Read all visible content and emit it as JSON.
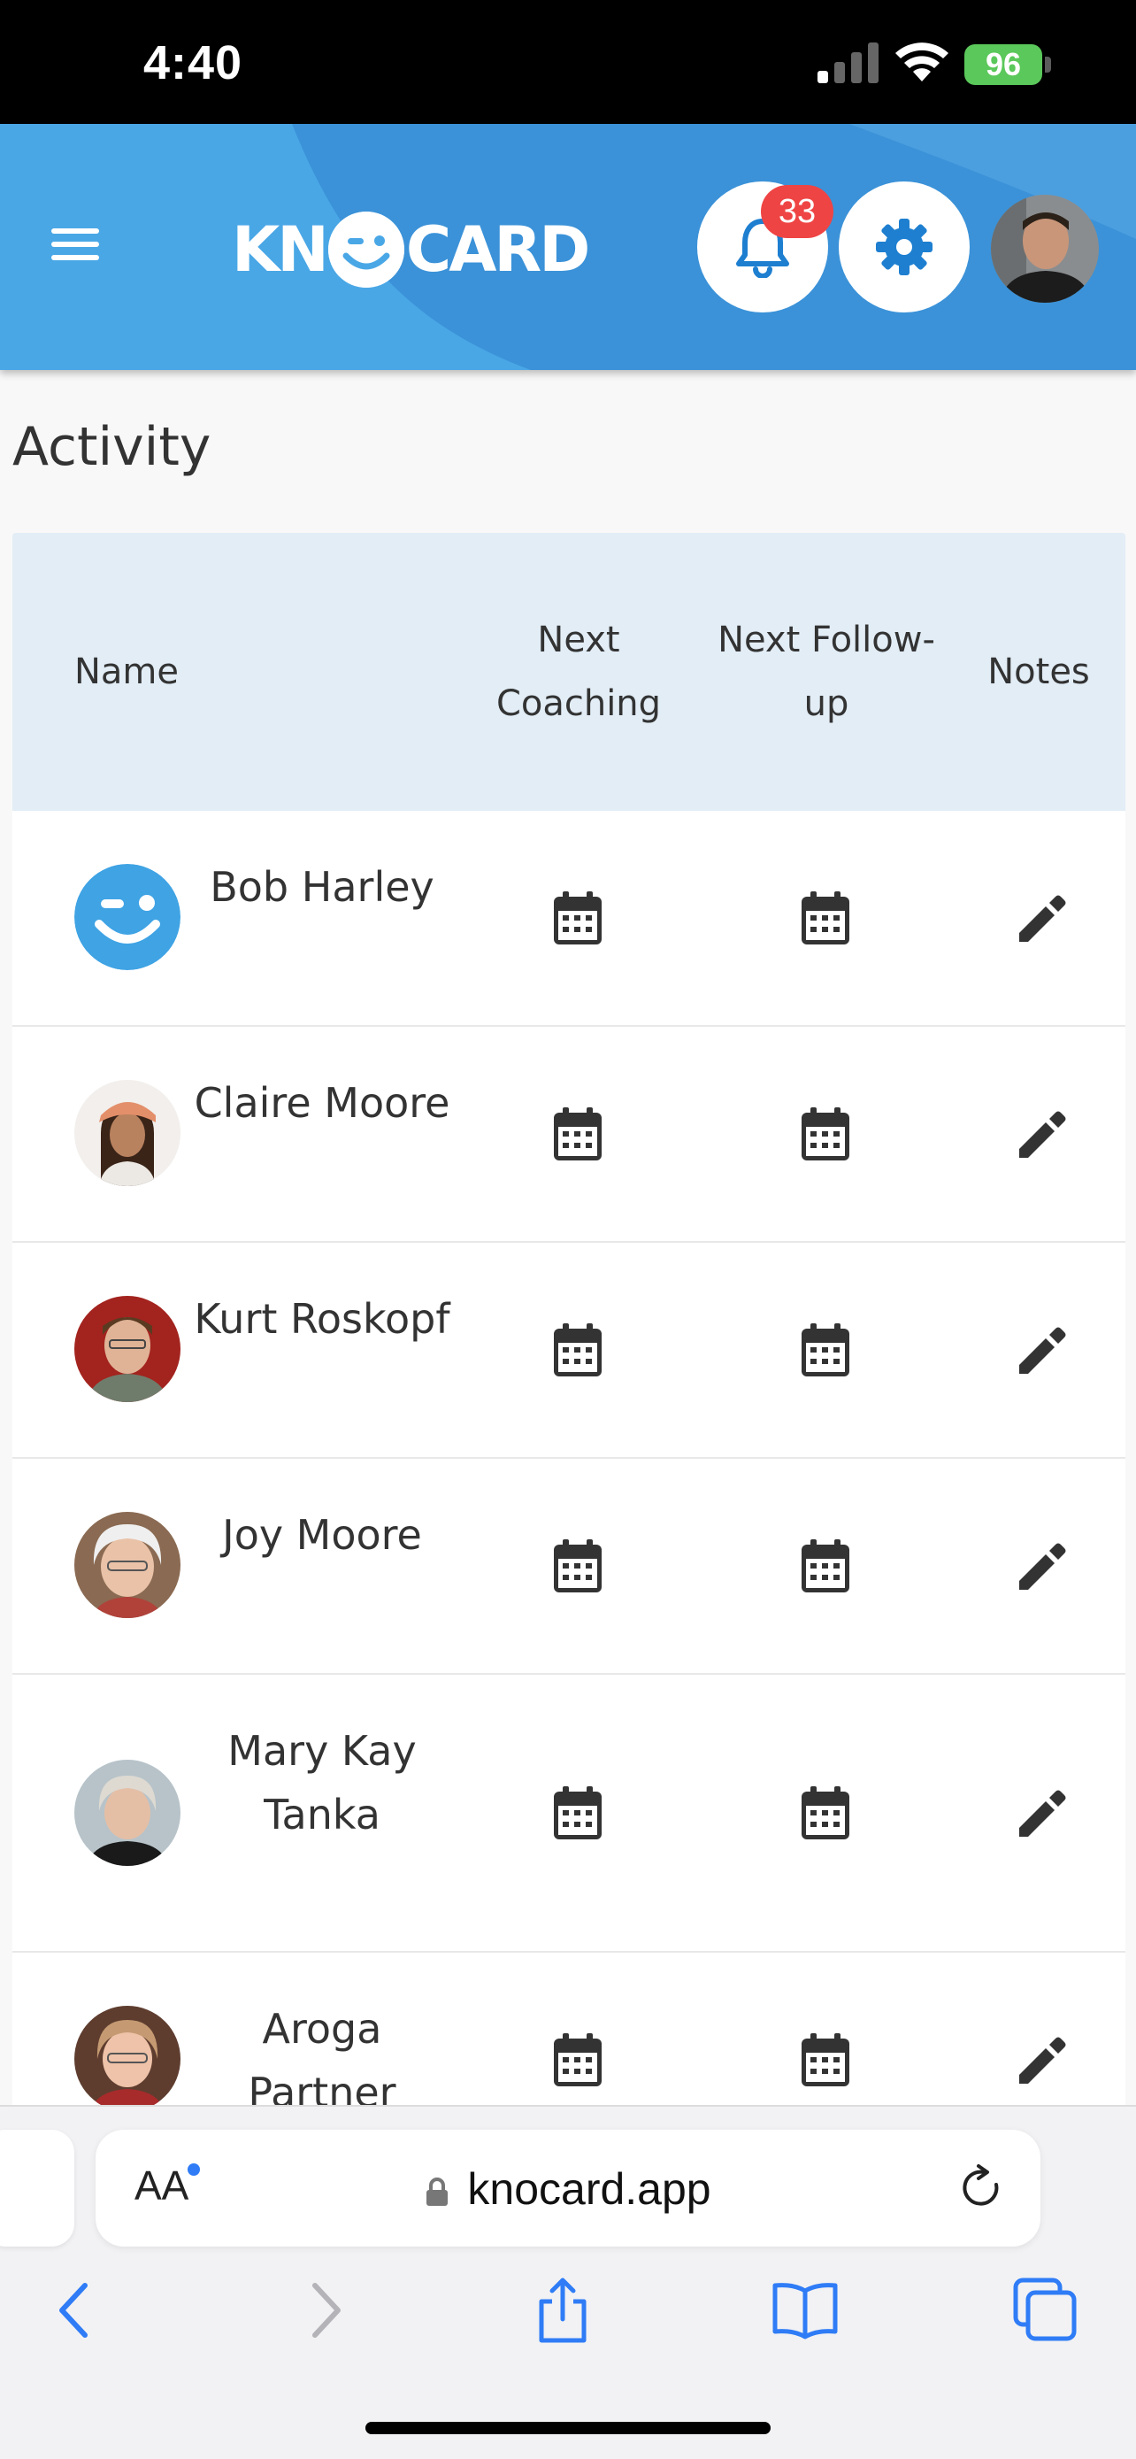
{
  "status_bar": {
    "time": "4:40",
    "battery": "96"
  },
  "header": {
    "logo_left": "KN",
    "logo_right": "CARD",
    "notification_count": "33",
    "brand_color": "#3b92d8"
  },
  "page": {
    "title": "Activity"
  },
  "table": {
    "columns": {
      "name": "Name",
      "next_coaching": "Next Coaching",
      "next_followup": "Next Follow-up",
      "notes": "Notes"
    },
    "rows": [
      {
        "name": "Bob Harley",
        "avatar": "knocard-logo"
      },
      {
        "name": "Claire Moore",
        "avatar": "photo"
      },
      {
        "name": "Kurt Roskopf",
        "avatar": "photo"
      },
      {
        "name": "Joy Moore",
        "avatar": "photo"
      },
      {
        "name": "Mary Kay Tanka",
        "avatar": "photo"
      },
      {
        "name": "Aroga Partner",
        "avatar": "photo"
      }
    ]
  },
  "browser": {
    "aa_label": "AA",
    "url": "knocard.app"
  },
  "icons": [
    "menu-icon",
    "bell-icon",
    "gear-icon",
    "calendar-icon",
    "pencil-icon",
    "lock-icon",
    "reload-icon",
    "back-icon",
    "forward-icon",
    "share-icon",
    "bookmarks-icon",
    "tabs-icon"
  ]
}
